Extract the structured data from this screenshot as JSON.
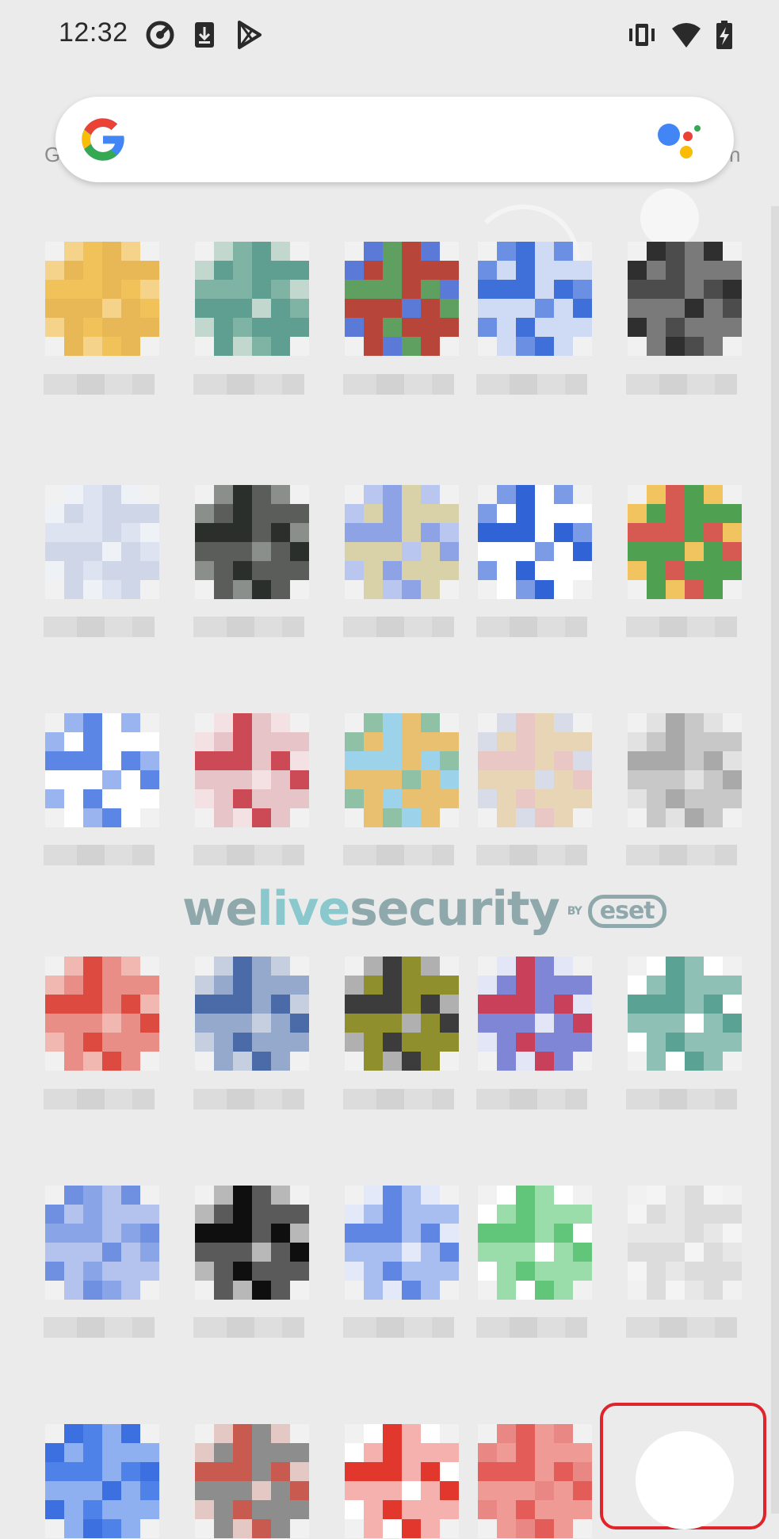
{
  "status_bar": {
    "time": "12:32",
    "left_icons": [
      "sync-icon",
      "download-icon",
      "play-store-icon"
    ],
    "right_icons": [
      "vibrate-icon",
      "wifi-icon",
      "battery-charging-icon"
    ]
  },
  "search_bar": {
    "logo": "google-g-logo",
    "assistant": "google-assistant-icon"
  },
  "edge_text": {
    "left": "G",
    "right": "h"
  },
  "watermark": {
    "prefix_1": "we",
    "highlight": "live",
    "suffix": "security",
    "by": "BY",
    "brand": "eset"
  },
  "colors": {
    "background": "#ebebeb",
    "highlight_border": "#e0242b",
    "watermark": "#8fa8ab",
    "watermark_highlight": "#8bc8cd"
  },
  "apps": [
    {
      "id": "app-1-1",
      "colors": [
        "#f2c25a",
        "#e9b856",
        "#f5d38a"
      ],
      "row": 0,
      "col": 0
    },
    {
      "id": "app-1-2",
      "colors": [
        "#7fb3a4",
        "#5e9f92",
        "#c2d8cf"
      ],
      "row": 0,
      "col": 1
    },
    {
      "id": "app-1-3",
      "colors": [
        "#5f9f5f",
        "#b7453a",
        "#5b79d6"
      ],
      "row": 0,
      "col": 2
    },
    {
      "id": "app-1-4",
      "colors": [
        "#3f6fd8",
        "#cfdaf4",
        "#6b8fe2"
      ],
      "row": 0,
      "col": 3
    },
    {
      "id": "app-1-5",
      "colors": [
        "#4c4c4c",
        "#7a7a7a",
        "#2f2f2f"
      ],
      "row": 0,
      "col": 4
    },
    {
      "id": "app-2-1",
      "colors": [
        "#dde3f0",
        "#cfd6e8",
        "#eef1f6"
      ],
      "row": 1,
      "col": 0
    },
    {
      "id": "app-2-2",
      "colors": [
        "#2b2f2c",
        "#5a5d5a",
        "#8b8f8b"
      ],
      "row": 1,
      "col": 1
    },
    {
      "id": "app-2-3",
      "colors": [
        "#8ea3e6",
        "#d9d2a9",
        "#b8c6f0"
      ],
      "row": 1,
      "col": 2
    },
    {
      "id": "app-2-4",
      "colors": [
        "#2f63d6",
        "#ffffff",
        "#7c9be6"
      ],
      "row": 1,
      "col": 3
    },
    {
      "id": "app-2-5",
      "colors": [
        "#d65a52",
        "#4fa050",
        "#f2c460"
      ],
      "row": 1,
      "col": 4
    },
    {
      "id": "app-3-1",
      "colors": [
        "#5b86e6",
        "#ffffff",
        "#9ab4ef"
      ],
      "row": 2,
      "col": 0
    },
    {
      "id": "app-3-2",
      "colors": [
        "#cc4a55",
        "#e7c4c8",
        "#f3e1e3"
      ],
      "row": 2,
      "col": 1
    },
    {
      "id": "app-3-3",
      "colors": [
        "#9cd2ea",
        "#e9c06f",
        "#8fc1a6"
      ],
      "row": 2,
      "col": 2
    },
    {
      "id": "app-3-4",
      "colors": [
        "#e8c7c4",
        "#e8d5b5",
        "#d8dbe8"
      ],
      "row": 2,
      "col": 3
    },
    {
      "id": "app-3-5",
      "colors": [
        "#a9a9a9",
        "#c8c8c8",
        "#e2e2e2"
      ],
      "row": 2,
      "col": 4
    },
    {
      "id": "app-4-1",
      "colors": [
        "#dc4a40",
        "#e88e86",
        "#f1b8b2"
      ],
      "row": 3,
      "col": 0
    },
    {
      "id": "app-4-2",
      "colors": [
        "#4a6ba8",
        "#95a9cc",
        "#c5cfe0"
      ],
      "row": 3,
      "col": 1
    },
    {
      "id": "app-4-3",
      "colors": [
        "#3c3c3c",
        "#8f8f2e",
        "#b0b0b0"
      ],
      "row": 3,
      "col": 2
    },
    {
      "id": "app-4-4",
      "colors": [
        "#c8405a",
        "#7f86d6",
        "#e3e6f6"
      ],
      "row": 3,
      "col": 3
    },
    {
      "id": "app-4-5",
      "colors": [
        "#5aa293",
        "#8fc0b6",
        "#ffffff"
      ],
      "row": 3,
      "col": 4
    },
    {
      "id": "app-5-1",
      "colors": [
        "#8aa4e8",
        "#b3c3ee",
        "#6f8fe0"
      ],
      "row": 4,
      "col": 0
    },
    {
      "id": "app-5-2",
      "colors": [
        "#0f0f0f",
        "#5a5a5a",
        "#b8b8b8"
      ],
      "row": 4,
      "col": 1
    },
    {
      "id": "app-5-3",
      "colors": [
        "#5f86e3",
        "#a8bdf0",
        "#e3e9f8"
      ],
      "row": 4,
      "col": 2
    },
    {
      "id": "app-5-4",
      "colors": [
        "#61c67a",
        "#9bdcab",
        "#ffffff"
      ],
      "row": 4,
      "col": 3
    },
    {
      "id": "app-5-5",
      "colors": [
        "#e7e7e7",
        "#dcdcdc",
        "#f4f4f4"
      ],
      "row": 4,
      "col": 4
    },
    {
      "id": "app-6-1",
      "colors": [
        "#4f82e8",
        "#8fb0f0",
        "#3c6fe0"
      ],
      "row": 5,
      "col": 0
    },
    {
      "id": "app-6-2",
      "colors": [
        "#c95a4f",
        "#8d8d8d",
        "#e4c8c4"
      ],
      "row": 5,
      "col": 1
    },
    {
      "id": "app-6-3",
      "colors": [
        "#e2372c",
        "#f4b1ad",
        "#ffffff"
      ],
      "row": 5,
      "col": 2
    },
    {
      "id": "app-6-4",
      "colors": [
        "#e35c57",
        "#f09a95",
        "#e88783"
      ],
      "row": 5,
      "col": 3
    }
  ]
}
